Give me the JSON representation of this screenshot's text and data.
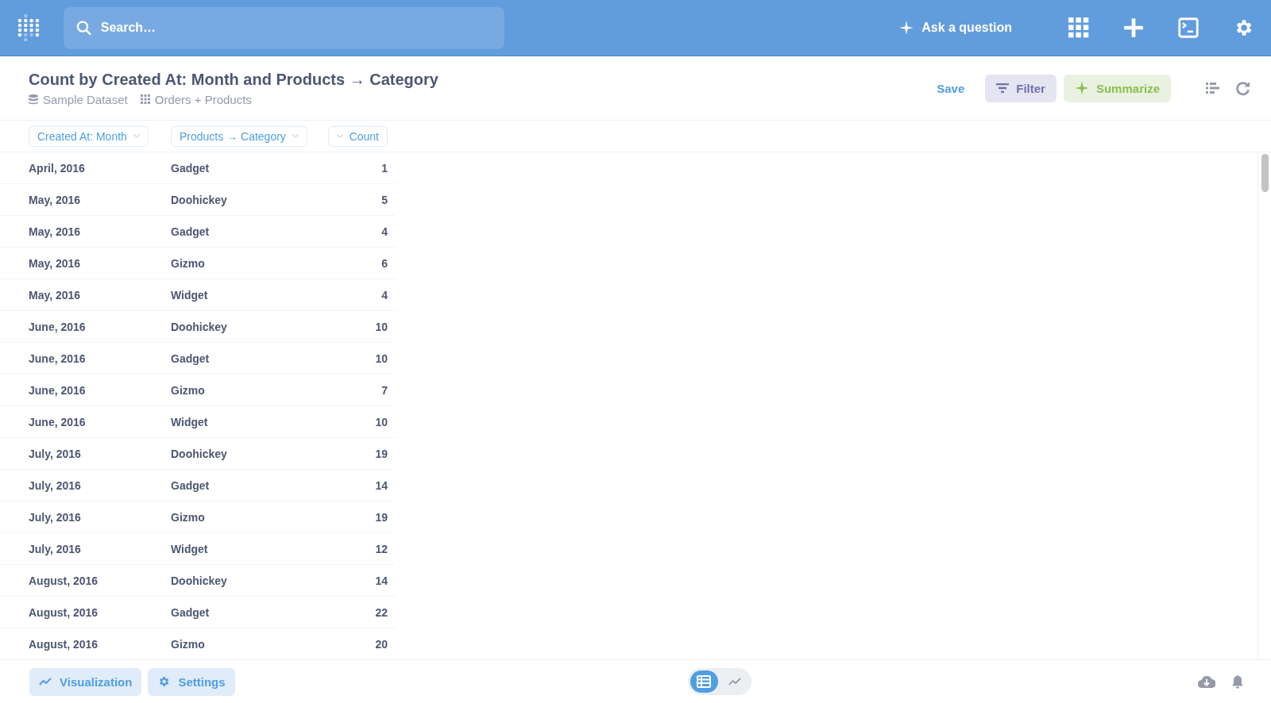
{
  "navbar": {
    "search": {
      "placeholder": "Search…"
    },
    "ask_button": "Ask a question"
  },
  "header": {
    "title": "Count by Created At: Month and Products → Category",
    "database": "Sample Dataset",
    "table": "Orders + Products",
    "actions": {
      "save": "Save",
      "filter": "Filter",
      "summarize": "Summarize"
    }
  },
  "table": {
    "columns": [
      {
        "label": "Created At: Month",
        "kind": "dimension"
      },
      {
        "label": "Products → Category",
        "kind": "dimension"
      },
      {
        "label": "Count",
        "kind": "metric"
      }
    ],
    "rows": [
      [
        "April, 2016",
        "Gadget",
        "1"
      ],
      [
        "May, 2016",
        "Doohickey",
        "5"
      ],
      [
        "May, 2016",
        "Gadget",
        "4"
      ],
      [
        "May, 2016",
        "Gizmo",
        "6"
      ],
      [
        "May, 2016",
        "Widget",
        "4"
      ],
      [
        "June, 2016",
        "Doohickey",
        "10"
      ],
      [
        "June, 2016",
        "Gadget",
        "10"
      ],
      [
        "June, 2016",
        "Gizmo",
        "7"
      ],
      [
        "June, 2016",
        "Widget",
        "10"
      ],
      [
        "July, 2016",
        "Doohickey",
        "19"
      ],
      [
        "July, 2016",
        "Gadget",
        "14"
      ],
      [
        "July, 2016",
        "Gizmo",
        "19"
      ],
      [
        "July, 2016",
        "Widget",
        "12"
      ],
      [
        "August, 2016",
        "Doohickey",
        "14"
      ],
      [
        "August, 2016",
        "Gadget",
        "22"
      ],
      [
        "August, 2016",
        "Gizmo",
        "20"
      ]
    ]
  },
  "footer": {
    "visualization": "Visualization",
    "settings": "Settings",
    "view_toggle": [
      {
        "kind": "table",
        "selected": true
      },
      {
        "kind": "chart",
        "selected": false
      }
    ]
  }
}
